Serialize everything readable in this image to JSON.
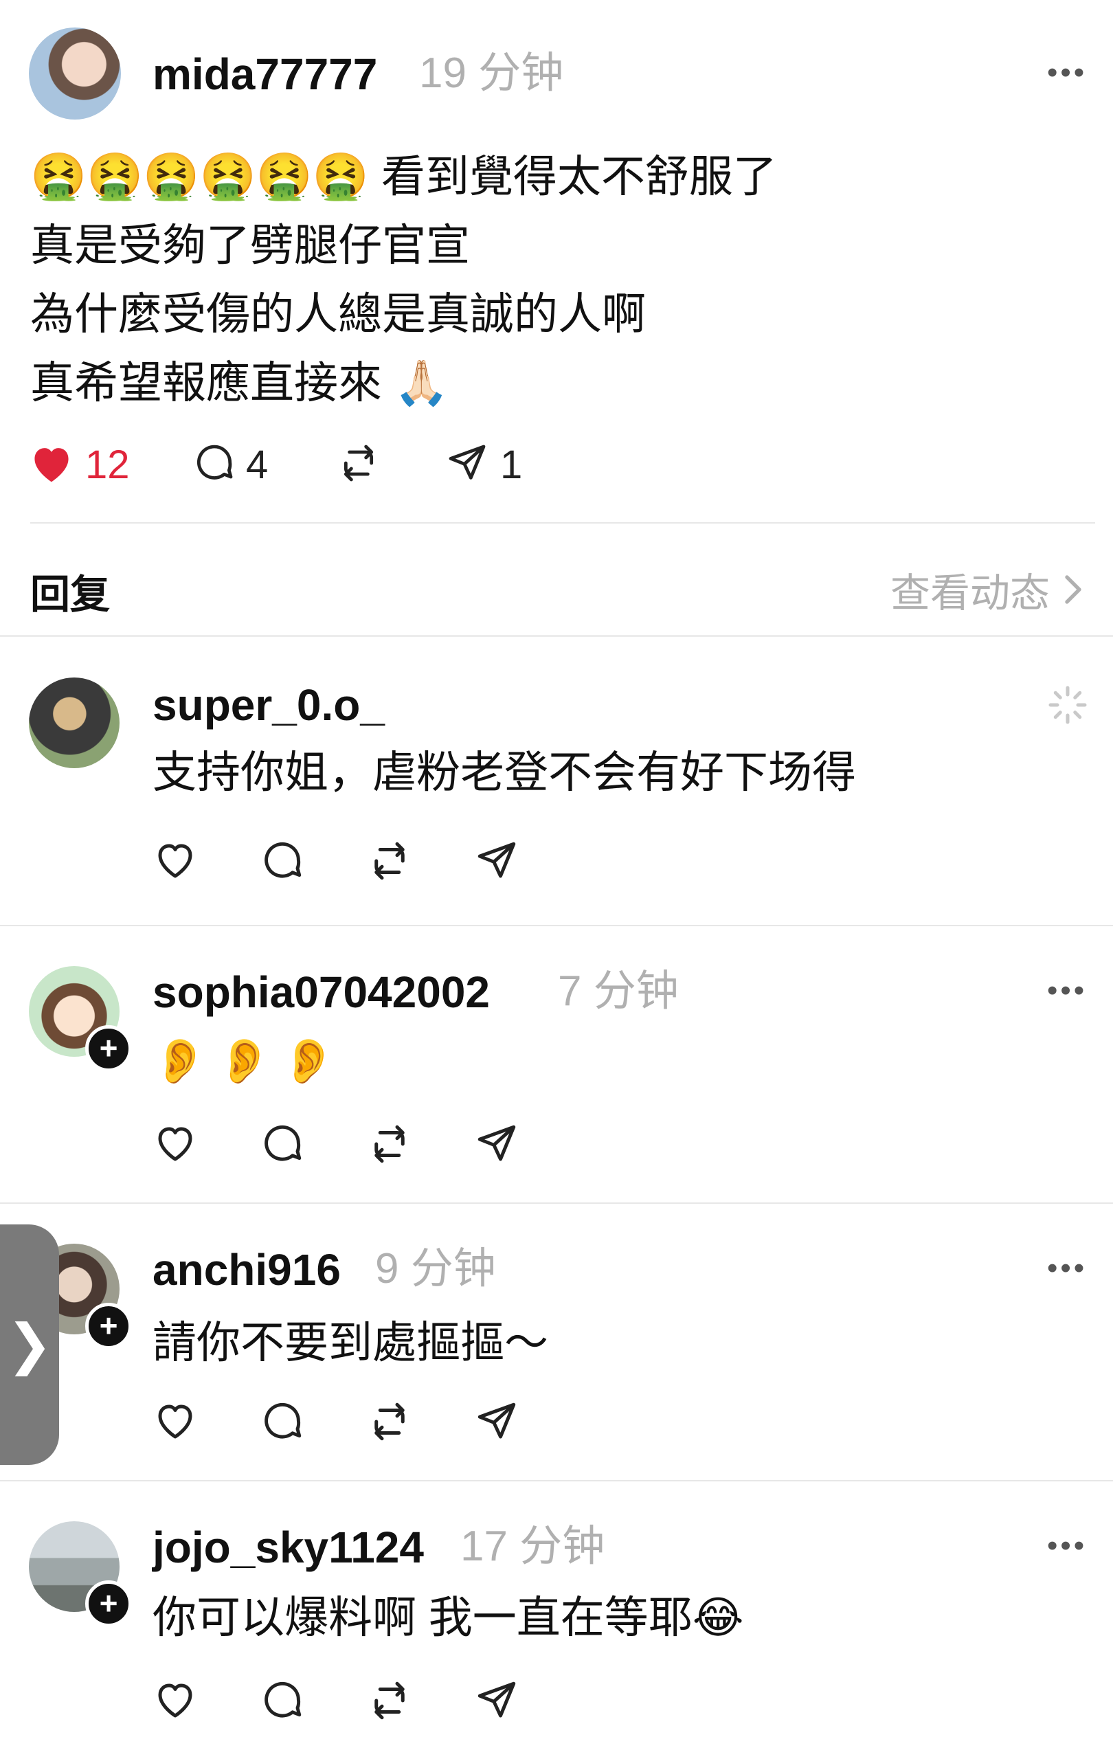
{
  "post": {
    "username": "mida77777",
    "time": "19 分钟",
    "lines": [
      "😫😫😫😫😫😫 看到覺得太不舒服了",
      "真是受夠了劈腿仔官宣",
      "為什麼受傷的人總是真誠的人啊",
      "真希望報應直接來 🙏🏻"
    ],
    "emoji_row": "🤮🤮🤮🤮🤮🤮",
    "line1_text": "看到覺得太不舒服了",
    "line4_text": "真希望報應直接來",
    "line4_emoji": "🙏🏻",
    "likes": "12",
    "comments": "4",
    "shares": "1"
  },
  "reply_bar": {
    "label": "回复",
    "activity_link": "查看动态"
  },
  "replies": [
    {
      "username": "super_0.o_",
      "time": "",
      "text": "支持你姐，虐粉老登不会有好下场得",
      "has_follow_badge": false
    },
    {
      "username": "sophia07042002",
      "time": "7 分钟",
      "text": "👂👂👂",
      "has_follow_badge": true
    },
    {
      "username": "anchi916",
      "time": "9 分钟",
      "text": "請你不要到處摳摳～",
      "has_follow_badge": true
    },
    {
      "username": "jojo_sky1124",
      "time": "17 分钟",
      "text": "你可以爆料啊 我一直在等耶😂",
      "has_follow_badge": true
    }
  ],
  "colors": {
    "heart": "#e0243a",
    "likes_text": "#e0243a",
    "muted": "#b0b0b0"
  },
  "icons": [
    "heart-icon",
    "comment-icon",
    "repost-icon",
    "share-icon",
    "more-icon",
    "loading-icon",
    "chevron-right-icon",
    "plus-icon"
  ]
}
